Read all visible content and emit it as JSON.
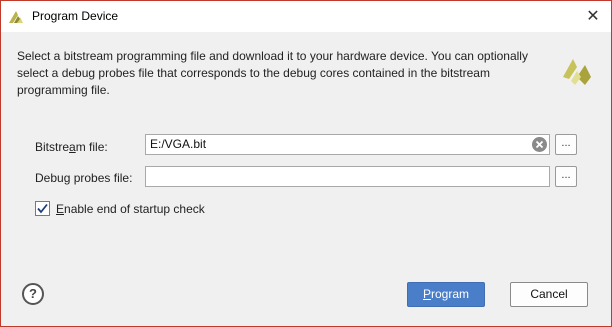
{
  "window": {
    "title": "Program Device",
    "close_glyph": "✕"
  },
  "description": "Select a bitstream programming file and download it to your hardware device. You can optionally select a debug probes file that corresponds to the debug cores contained in the bitstream programming file.",
  "fields": {
    "bitstream": {
      "label_pre": "Bitstre",
      "label_ul": "a",
      "label_post": "m file:",
      "value": "E:/VGA.bit",
      "browse": "..."
    },
    "probes": {
      "label_pre": "Debu",
      "label_ul": "g",
      "label_post": " probes file:",
      "value": "",
      "browse": "..."
    }
  },
  "startup_check": {
    "label_ul": "E",
    "label_rest": "nable end of startup check",
    "checked": true
  },
  "buttons": {
    "help": "?",
    "program_ul": "P",
    "program_rest": "rogram",
    "cancel": "Cancel"
  },
  "icons": [
    "app-logo-icon",
    "close-icon",
    "xilinx-logo-icon",
    "clear-icon",
    "checkmark-icon",
    "help-icon"
  ],
  "colors": {
    "accent": "#4a7ec9",
    "logo": "#c8c25a"
  }
}
